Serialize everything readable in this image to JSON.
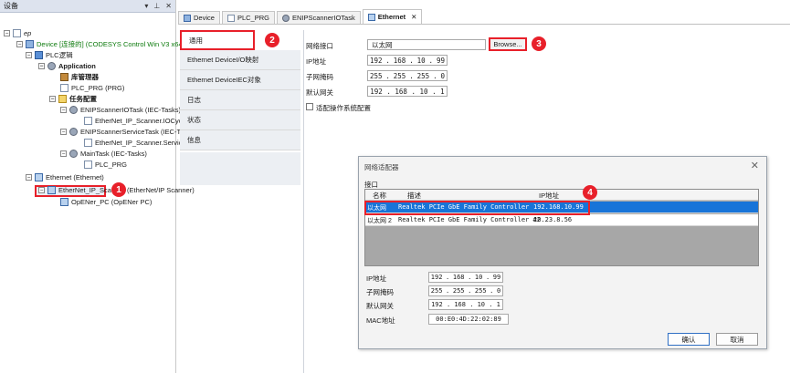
{
  "device_pane": {
    "title": "设备",
    "controls": [
      "▾",
      "⊥",
      "✕"
    ],
    "tree": [
      {
        "label": "ep",
        "toggle": "−",
        "icon": "project-icon"
      },
      {
        "label": "Device [连接的] (CODESYS Control Win V3 x64)",
        "toggle": "−",
        "icon": "device-icon"
      },
      {
        "label": "PLC逻辑",
        "toggle": "−",
        "icon": "plc-logic-icon"
      },
      {
        "label": "Application",
        "toggle": "−",
        "icon": "gear-icon"
      },
      {
        "label": "库管理器",
        "toggle": "",
        "icon": "library-icon"
      },
      {
        "label": "PLC_PRG (PRG)",
        "toggle": "",
        "icon": "document-icon"
      },
      {
        "label": "任务配置",
        "toggle": "−",
        "icon": "task-config-icon"
      },
      {
        "label": "ENIPScannerIOTask (IEC-Tasks)",
        "toggle": "−",
        "icon": "task-icon"
      },
      {
        "label": "EtherNet_IP_Scanner.IOCycle",
        "toggle": "",
        "icon": "call-icon"
      },
      {
        "label": "ENIPScannerServiceTask (IEC-Tasks)",
        "toggle": "−",
        "icon": "task-icon"
      },
      {
        "label": "EtherNet_IP_Scanner.ServiceCycle",
        "toggle": "",
        "icon": "call-icon"
      },
      {
        "label": "MainTask (IEC-Tasks)",
        "toggle": "−",
        "icon": "task-icon"
      },
      {
        "label": "PLC_PRG",
        "toggle": "",
        "icon": "call-icon"
      },
      {
        "label": "Ethernet (Ethernet)",
        "toggle": "−",
        "icon": "ethernet-icon"
      },
      {
        "label": "EtherNet_IP_Scanner (EtherNet/IP Scanner)",
        "toggle": "−",
        "icon": "scanner-icon"
      },
      {
        "label": "OpENer_PC (OpENer PC)",
        "toggle": "",
        "icon": "adapter-icon"
      }
    ],
    "badge": "1"
  },
  "tabs": [
    {
      "label": "Device",
      "icon": "device-icon"
    },
    {
      "label": "PLC_PRG",
      "icon": "document-icon"
    },
    {
      "label": "ENIPScannerIOTask",
      "icon": "task-icon"
    },
    {
      "label": "Ethernet",
      "icon": "ethernet-icon",
      "close": "✕"
    }
  ],
  "side_tabs": [
    {
      "label": "通用"
    },
    {
      "label": "Ethernet DeviceI/O映射"
    },
    {
      "label": "Ethernet DeviceIEC对象"
    },
    {
      "label": "日志"
    },
    {
      "label": "状态"
    },
    {
      "label": "信息"
    }
  ],
  "general": {
    "interface_label": "网络接口",
    "interface_value": "以太网",
    "browse_label": "Browse...",
    "ip_label": "IP地址",
    "ip": [
      "192",
      "168",
      "10",
      "99"
    ],
    "subnet_label": "子网掩码",
    "subnet": [
      "255",
      "255",
      "255",
      "0"
    ],
    "gateway_label": "默认网关",
    "gateway": [
      "192",
      "168",
      "10",
      "1"
    ],
    "adapt_os_label": "适配操作系统配置"
  },
  "badges": {
    "side": "2",
    "browse": "3",
    "row": "4"
  },
  "dialog": {
    "title": "网络适配器",
    "close": "✕",
    "group_label": "接口",
    "columns": [
      "名称",
      "描述",
      "IP地址"
    ],
    "rows": [
      {
        "name": "以太网",
        "desc": "Realtek PCIe GbE Family Controller",
        "ip": "192.168.10.99"
      },
      {
        "name": "以太网 2",
        "desc": "Realtek PCIe GbE Family Controller #2",
        "ip": "10.23.8.56"
      }
    ],
    "ip_label": "IP地址",
    "ip": [
      "192",
      "168",
      "10",
      "99"
    ],
    "subnet_label": "子网掩码",
    "subnet": [
      "255",
      "255",
      "255",
      "0"
    ],
    "gateway_label": "默认网关",
    "gateway": [
      "192",
      "168",
      "10",
      "1"
    ],
    "mac_label": "MAC地址",
    "mac": "00:E0:4D:22:02:89",
    "ok_label": "确认",
    "cancel_label": "取消"
  }
}
